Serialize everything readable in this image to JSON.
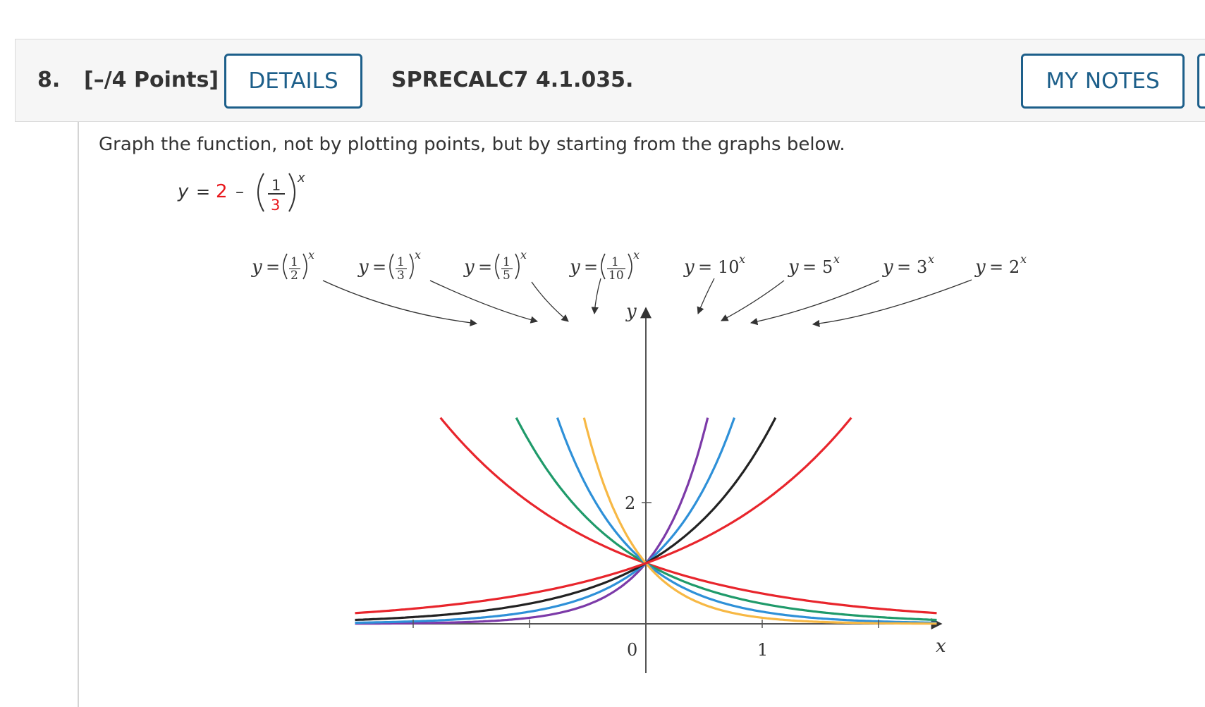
{
  "question": {
    "number": "8.",
    "points": "[–/4 Points]",
    "details_label": "DETAILS",
    "code": "SPRECALC7 4.1.035.",
    "my_notes_label": "MY NOTES"
  },
  "prompt": "Graph the function, not by plotting points, but by starting from the graphs below.",
  "equation": {
    "lhs": "y",
    "equals": "=",
    "constant": "2",
    "minus": "–",
    "numerator": "1",
    "denominator": "3",
    "exponent": "x",
    "highlight_color": "#e8161b"
  },
  "chart_data": {
    "type": "line",
    "xlabel": "x",
    "ylabel": "y",
    "xlim": [
      -2.5,
      2.5
    ],
    "ylim": [
      0,
      3.4
    ],
    "x_ticks": [
      -2,
      -1,
      0,
      1,
      2
    ],
    "x_tick_labels": [
      {
        "x": 0,
        "label": "0"
      },
      {
        "x": 1,
        "label": "1"
      }
    ],
    "y_ticks": [
      2
    ],
    "y_tick_labels": [
      {
        "y": 2,
        "label": "2"
      }
    ],
    "grid": false,
    "series": [
      {
        "base": 0.5,
        "color": "#e8252c",
        "label": {
          "y": "y",
          "eq": "=",
          "num": "1",
          "den": "2",
          "sup": "x"
        }
      },
      {
        "base": 0.3333,
        "color": "#1f9a6a",
        "label": {
          "y": "y",
          "eq": "=",
          "num": "1",
          "den": "3",
          "sup": "x"
        }
      },
      {
        "base": 0.2,
        "color": "#2e90d8",
        "label": {
          "y": "y",
          "eq": "=",
          "num": "1",
          "den": "5",
          "sup": "x"
        }
      },
      {
        "base": 0.1,
        "color": "#f7b844",
        "label": {
          "y": "y",
          "eq": "=",
          "num": "1",
          "den": "10",
          "sup": "x"
        }
      },
      {
        "base": 10,
        "color": "#7c3aa8",
        "label": {
          "y": "y",
          "eq": "=",
          "base": "10",
          "sup": "x"
        }
      },
      {
        "base": 5,
        "color": "#2e90d8",
        "label": {
          "y": "y",
          "eq": "=",
          "base": "5",
          "sup": "x"
        }
      },
      {
        "base": 3,
        "color": "#222222",
        "label": {
          "y": "y",
          "eq": "=",
          "base": "3",
          "sup": "x"
        }
      },
      {
        "base": 2,
        "color": "#e8252c",
        "label": {
          "y": "y",
          "eq": "=",
          "base": "2",
          "sup": "x"
        }
      }
    ]
  }
}
